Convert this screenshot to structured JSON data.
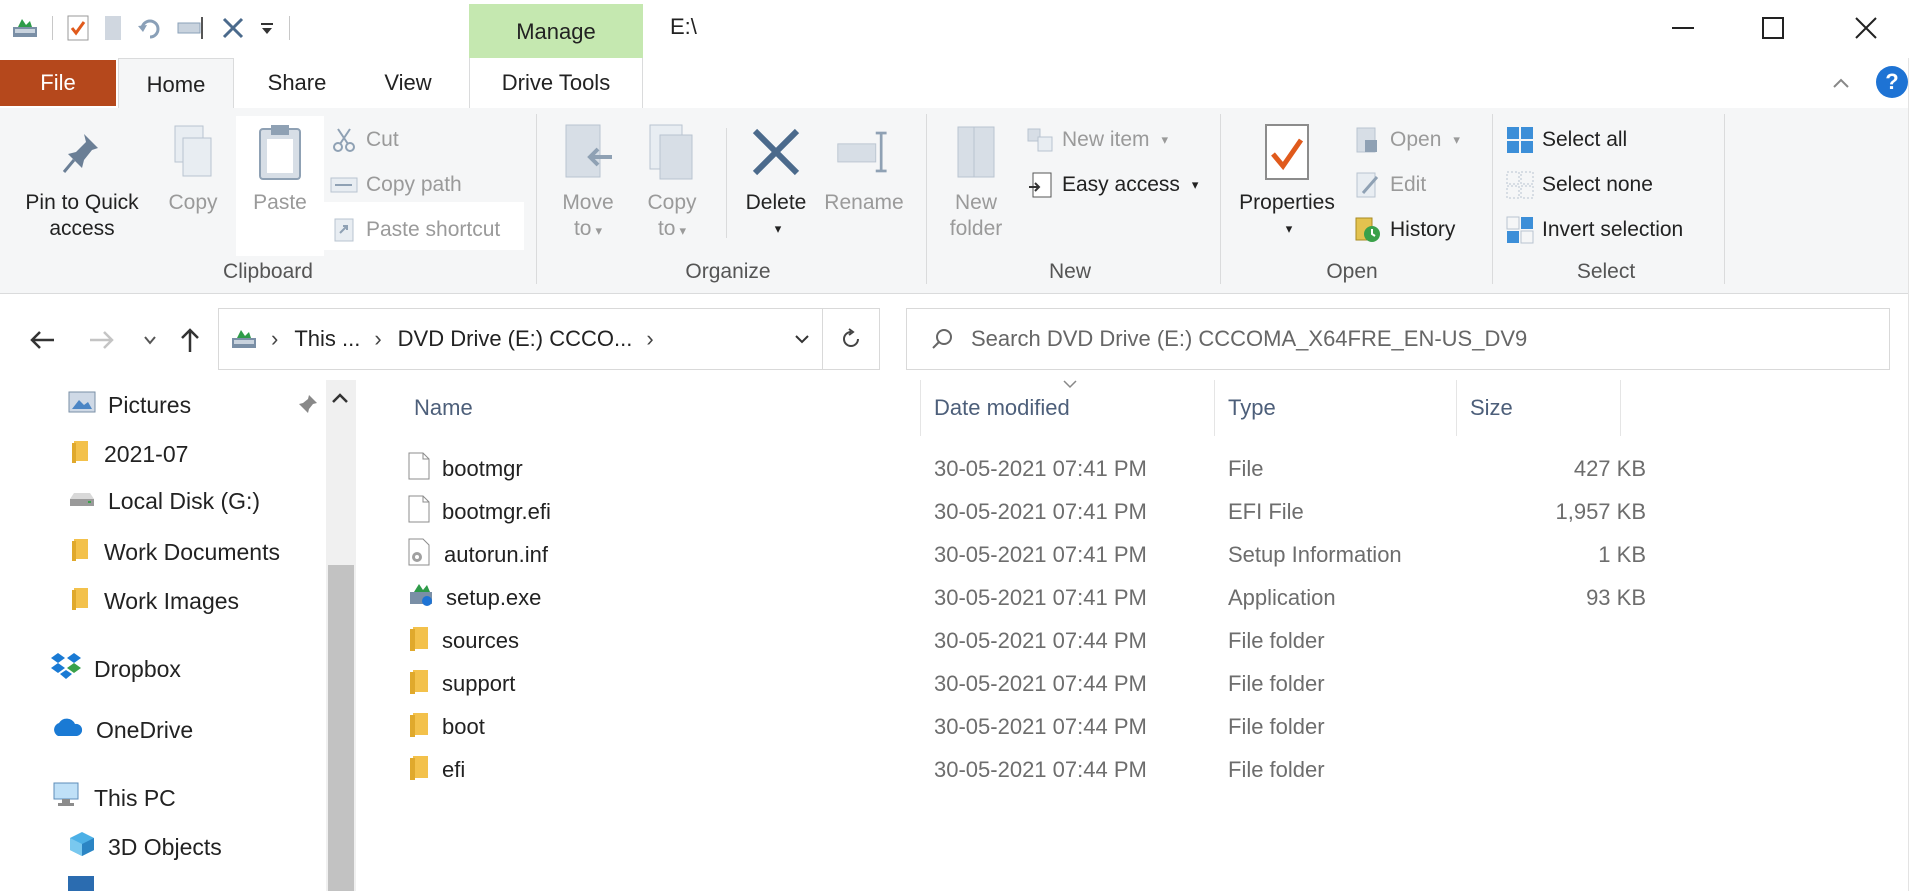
{
  "window": {
    "title": "E:\\",
    "context_tab": "Manage",
    "controls": {
      "minimize": "—",
      "maximize": "☐",
      "close": "✕"
    }
  },
  "ribbon_tabs": {
    "file": "File",
    "home": "Home",
    "share": "Share",
    "view": "View",
    "drive_tools": "Drive Tools",
    "help": "?"
  },
  "ribbon": {
    "clipboard": {
      "label": "Clipboard",
      "pin_line1": "Pin to Quick",
      "pin_line2": "access",
      "copy": "Copy",
      "paste": "Paste",
      "cut": "Cut",
      "copy_path": "Copy path",
      "paste_shortcut": "Paste shortcut"
    },
    "organize": {
      "label": "Organize",
      "move_to_line1": "Move",
      "move_to_line2": "to",
      "copy_to_line1": "Copy",
      "copy_to_line2": "to",
      "delete": "Delete",
      "rename": "Rename"
    },
    "new": {
      "label": "New",
      "new_folder_line1": "New",
      "new_folder_line2": "folder",
      "new_item": "New item",
      "easy_access": "Easy access"
    },
    "open": {
      "label": "Open",
      "properties": "Properties",
      "open": "Open",
      "edit": "Edit",
      "history": "History"
    },
    "select": {
      "label": "Select",
      "select_all": "Select all",
      "select_none": "Select none",
      "invert_selection": "Invert selection"
    }
  },
  "address": {
    "crumb1": "This ...",
    "crumb2": "DVD Drive (E:) CCCO...",
    "search_placeholder": "Search DVD Drive (E:) CCCOMA_X64FRE_EN-US_DV9"
  },
  "sidebar": {
    "items": [
      {
        "label": "Pictures",
        "icon": "pictures-icon"
      },
      {
        "label": "2021-07",
        "icon": "folder-icon"
      },
      {
        "label": "Local Disk (G:)",
        "icon": "drive-icon"
      },
      {
        "label": "Work Documents",
        "icon": "folder-icon"
      },
      {
        "label": "Work Images",
        "icon": "folder-icon"
      },
      {
        "label": "Dropbox",
        "icon": "dropbox-icon"
      },
      {
        "label": "OneDrive",
        "icon": "onedrive-icon"
      },
      {
        "label": "This PC",
        "icon": "pc-icon"
      },
      {
        "label": "3D Objects",
        "icon": "3d-objects-icon"
      }
    ]
  },
  "file_list": {
    "columns": {
      "name": "Name",
      "date": "Date modified",
      "type": "Type",
      "size": "Size"
    },
    "rows": [
      {
        "name": "bootmgr",
        "date": "30-05-2021 07:41 PM",
        "type": "File",
        "size": "427 KB",
        "icon": "file-icon"
      },
      {
        "name": "bootmgr.efi",
        "date": "30-05-2021 07:41 PM",
        "type": "EFI File",
        "size": "1,957 KB",
        "icon": "file-icon"
      },
      {
        "name": "autorun.inf",
        "date": "30-05-2021 07:41 PM",
        "type": "Setup Information",
        "size": "1 KB",
        "icon": "setup-info-icon"
      },
      {
        "name": "setup.exe",
        "date": "30-05-2021 07:41 PM",
        "type": "Application",
        "size": "93 KB",
        "icon": "setup-exe-icon"
      },
      {
        "name": "sources",
        "date": "30-05-2021 07:44 PM",
        "type": "File folder",
        "size": "",
        "icon": "folder-icon"
      },
      {
        "name": "support",
        "date": "30-05-2021 07:44 PM",
        "type": "File folder",
        "size": "",
        "icon": "folder-icon"
      },
      {
        "name": "boot",
        "date": "30-05-2021 07:44 PM",
        "type": "File folder",
        "size": "",
        "icon": "folder-icon"
      },
      {
        "name": "efi",
        "date": "30-05-2021 07:44 PM",
        "type": "File folder",
        "size": "",
        "icon": "folder-icon"
      }
    ]
  },
  "colors": {
    "file_tab": "#b5481c",
    "manage_tab": "#c5e8b0",
    "ribbon_bg": "#f5f6f7",
    "folder": "#f3c14b",
    "accent": "#1e73d4"
  }
}
